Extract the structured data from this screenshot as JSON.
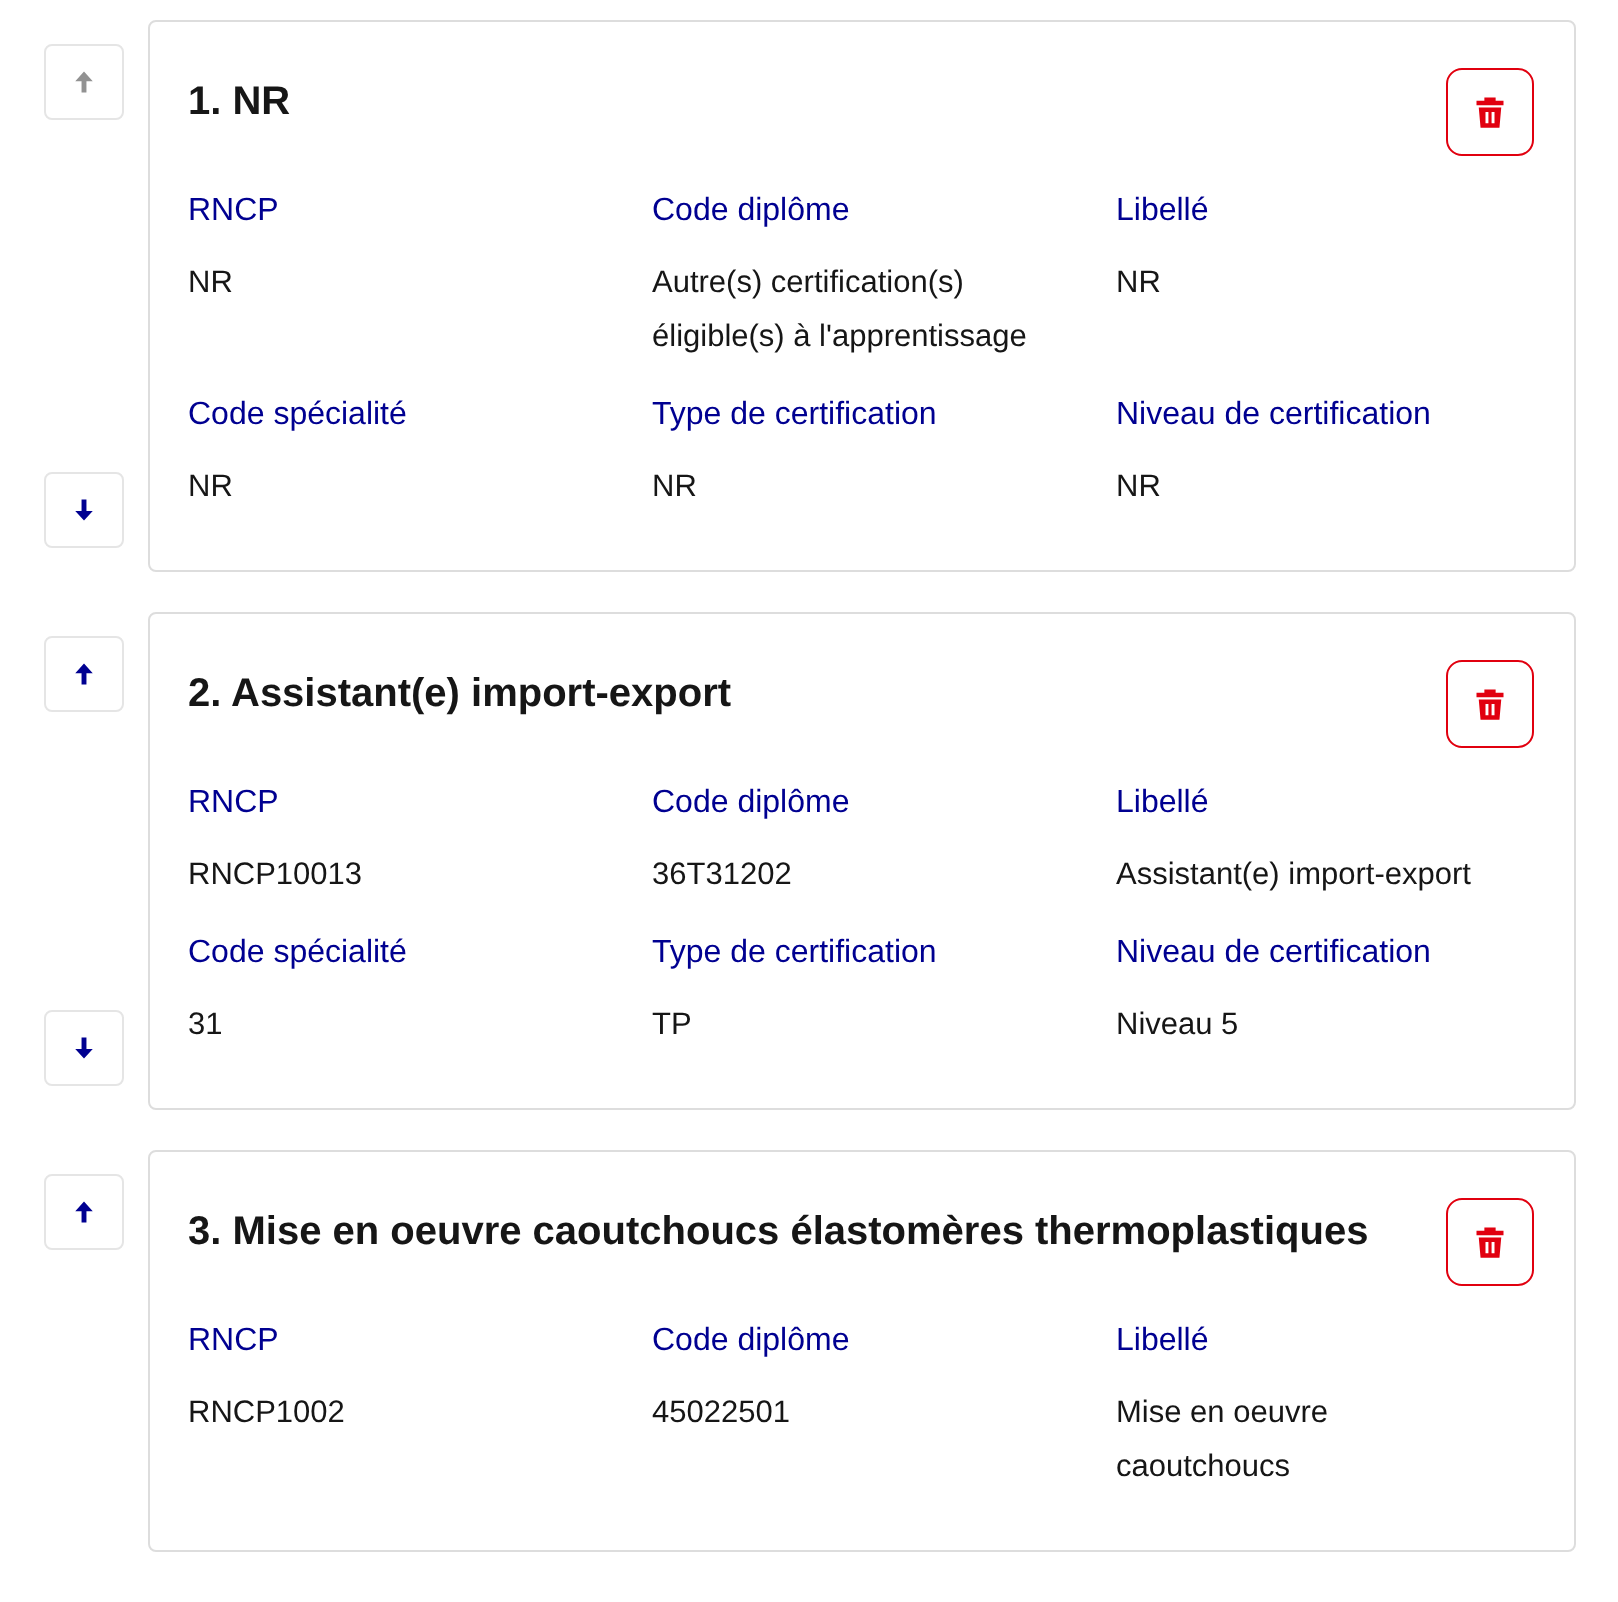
{
  "cards": [
    {
      "title": "1. NR",
      "up": {
        "disabled": true
      },
      "down": {
        "disabled": false
      },
      "fields": [
        {
          "label": "RNCP",
          "value": "NR"
        },
        {
          "label": "Code diplôme",
          "value": "Autre(s) certification(s) éligible(s) à l'apprentissage"
        },
        {
          "label": "Libellé",
          "value": "NR"
        },
        {
          "label": "Code spécialité",
          "value": "NR"
        },
        {
          "label": "Type de certification",
          "value": "NR"
        },
        {
          "label": "Niveau de certification",
          "value": "NR"
        }
      ]
    },
    {
      "title": "2. Assistant(e) import-export",
      "up": {
        "disabled": false
      },
      "down": {
        "disabled": false
      },
      "fields": [
        {
          "label": "RNCP",
          "value": "RNCP10013"
        },
        {
          "label": "Code diplôme",
          "value": "36T31202"
        },
        {
          "label": "Libellé",
          "value": "Assistant(e) import-export"
        },
        {
          "label": "Code spécialité",
          "value": "31"
        },
        {
          "label": "Type de certification",
          "value": "TP"
        },
        {
          "label": "Niveau de certification",
          "value": "Niveau 5"
        }
      ]
    },
    {
      "title": "3. Mise en oeuvre caoutchoucs élastomères thermoplastiques",
      "up": {
        "disabled": false
      },
      "fields": [
        {
          "label": "RNCP",
          "value": "RNCP1002"
        },
        {
          "label": "Code diplôme",
          "value": "45022501"
        },
        {
          "label": "Libellé",
          "value": "Mise en oeuvre caoutchoucs"
        }
      ]
    }
  ]
}
